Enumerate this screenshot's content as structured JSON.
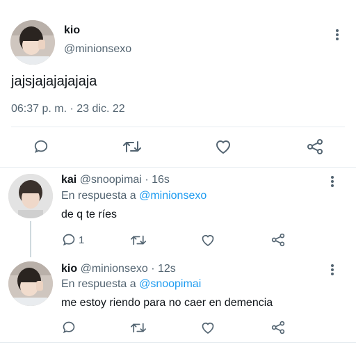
{
  "main_tweet": {
    "name": "kio",
    "handle": "@minionsexo",
    "text": "jajsjajajajajaja",
    "timestamp": "06:37 p. m. · 23 dic. 22"
  },
  "replies": [
    {
      "name": "kai",
      "handle": "@snoopimai",
      "time": "16s",
      "reply_to_label": "En respuesta a",
      "reply_to": "@minionsexo",
      "text": "de q te ríes",
      "reply_count": "1"
    },
    {
      "name": "kio",
      "handle": "@minionsexo",
      "time": "12s",
      "reply_to_label": "En respuesta a",
      "reply_to": "@snoopimai",
      "text": "me estoy riendo para no caer en demencia",
      "reply_count": ""
    }
  ],
  "icons": [
    "more-icon",
    "reply-icon",
    "retweet-icon",
    "like-icon",
    "share-icon"
  ],
  "colors": {
    "link": "#1d9bf0",
    "muted": "#536471",
    "text": "#0f1419",
    "divider": "#e6ecf0"
  }
}
